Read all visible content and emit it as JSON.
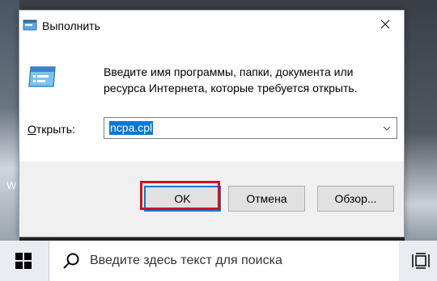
{
  "desktop": {
    "partial_text": "W"
  },
  "dialog": {
    "title": "Выполнить",
    "description": "Введите имя программы, папки, документа или ресурса Интернета, которые требуется открыть.",
    "open_label_accel": "О",
    "open_label_rest": "ткрыть:",
    "combo_value": "ncpa.cpl",
    "buttons": {
      "ok": "OK",
      "cancel": "Отмена",
      "browse": "Обзор..."
    }
  },
  "taskbar": {
    "search_placeholder": "Введите здесь текст для поиска"
  },
  "colors": {
    "selection": "#0078d7",
    "highlight": "#d40f1e"
  },
  "icons": [
    "run-app-icon",
    "close-icon",
    "chevron-down-icon",
    "windows-start-icon",
    "search-icon",
    "task-view-icon"
  ]
}
